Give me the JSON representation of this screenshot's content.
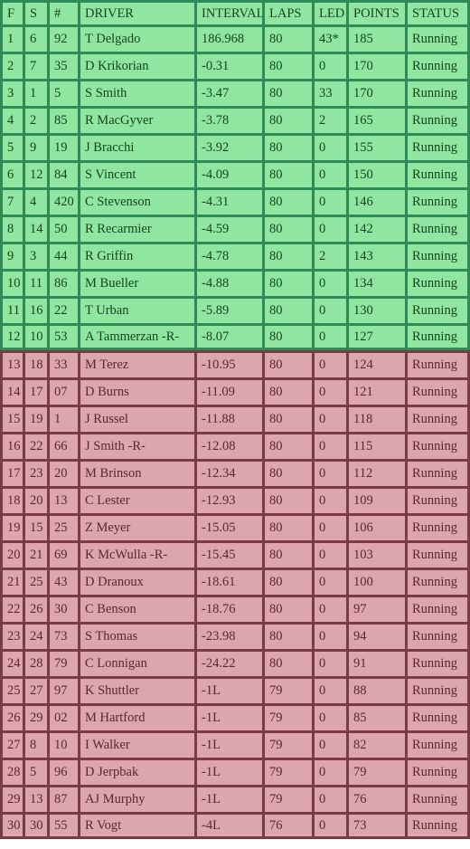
{
  "table": {
    "columns": [
      {
        "key": "f",
        "label": "F",
        "cls": "c-f"
      },
      {
        "key": "s",
        "label": "S",
        "cls": "c-s"
      },
      {
        "key": "num",
        "label": "#",
        "cls": "c-num"
      },
      {
        "key": "driver",
        "label": "DRIVER",
        "cls": "c-driver"
      },
      {
        "key": "interval",
        "label": "INTERVAL",
        "cls": "c-interval"
      },
      {
        "key": "laps",
        "label": "LAPS",
        "cls": "c-laps"
      },
      {
        "key": "led",
        "label": "LED",
        "cls": "c-led"
      },
      {
        "key": "points",
        "label": "POINTS",
        "cls": "c-points"
      },
      {
        "key": "status",
        "label": "STATUS",
        "cls": "c-status"
      }
    ],
    "colors": {
      "green_cell": "#90e6a0",
      "green_border": "#2e8b57",
      "green_text": "#14451e",
      "pink_cell": "#dda5ad",
      "pink_border": "#7b3b45",
      "pink_text": "#5d2630"
    },
    "rows": [
      {
        "group": "green",
        "f": "1",
        "s": "6",
        "num": "92",
        "driver": "T Delgado",
        "interval": "186.968",
        "laps": "80",
        "led": "43*",
        "points": "185",
        "status": "Running"
      },
      {
        "group": "green",
        "f": "2",
        "s": "7",
        "num": "35",
        "driver": "D Krikorian",
        "interval": "-0.31",
        "laps": "80",
        "led": "0",
        "points": "170",
        "status": "Running"
      },
      {
        "group": "green",
        "f": "3",
        "s": "1",
        "num": "5",
        "driver": "S Smith",
        "interval": "-3.47",
        "laps": "80",
        "led": "33",
        "points": "170",
        "status": "Running"
      },
      {
        "group": "green",
        "f": "4",
        "s": "2",
        "num": "85",
        "driver": "R MacGyver",
        "interval": "-3.78",
        "laps": "80",
        "led": "2",
        "points": "165",
        "status": "Running"
      },
      {
        "group": "green",
        "f": "5",
        "s": "9",
        "num": "19",
        "driver": "J Bracchi",
        "interval": "-3.92",
        "laps": "80",
        "led": "0",
        "points": "155",
        "status": "Running"
      },
      {
        "group": "green",
        "f": "6",
        "s": "12",
        "num": "84",
        "driver": "S Vincent",
        "interval": "-4.09",
        "laps": "80",
        "led": "0",
        "points": "150",
        "status": "Running"
      },
      {
        "group": "green",
        "f": "7",
        "s": "4",
        "num": "420",
        "driver": "C Stevenson",
        "interval": "-4.31",
        "laps": "80",
        "led": "0",
        "points": "146",
        "status": "Running"
      },
      {
        "group": "green",
        "f": "8",
        "s": "14",
        "num": "50",
        "driver": "R Recarmier",
        "interval": "-4.59",
        "laps": "80",
        "led": "0",
        "points": "142",
        "status": "Running"
      },
      {
        "group": "green",
        "f": "9",
        "s": "3",
        "num": "44",
        "driver": "R Griffin",
        "interval": "-4.78",
        "laps": "80",
        "led": "2",
        "points": "143",
        "status": "Running"
      },
      {
        "group": "green",
        "f": "10",
        "s": "11",
        "num": "86",
        "driver": "M Bueller",
        "interval": "-4.88",
        "laps": "80",
        "led": "0",
        "points": "134",
        "status": "Running"
      },
      {
        "group": "green",
        "f": "11",
        "s": "16",
        "num": "22",
        "driver": "T Urban",
        "interval": "-5.89",
        "laps": "80",
        "led": "0",
        "points": "130",
        "status": "Running"
      },
      {
        "group": "green",
        "f": "12",
        "s": "10",
        "num": "53",
        "driver": "A Tammerzan -R-",
        "interval": "-8.07",
        "laps": "80",
        "led": "0",
        "points": "127",
        "status": "Running"
      },
      {
        "group": "pink",
        "f": "13",
        "s": "18",
        "num": "33",
        "driver": "M Terez",
        "interval": "-10.95",
        "laps": "80",
        "led": "0",
        "points": "124",
        "status": "Running"
      },
      {
        "group": "pink",
        "f": "14",
        "s": "17",
        "num": "07",
        "driver": "D Burns",
        "interval": "-11.09",
        "laps": "80",
        "led": "0",
        "points": "121",
        "status": "Running"
      },
      {
        "group": "pink",
        "f": "15",
        "s": "19",
        "num": "1",
        "driver": "J Russel",
        "interval": "-11.88",
        "laps": "80",
        "led": "0",
        "points": "118",
        "status": "Running"
      },
      {
        "group": "pink",
        "f": "16",
        "s": "22",
        "num": "66",
        "driver": "J Smith -R-",
        "interval": "-12.08",
        "laps": "80",
        "led": "0",
        "points": "115",
        "status": "Running"
      },
      {
        "group": "pink",
        "f": "17",
        "s": "23",
        "num": "20",
        "driver": "M Brinson",
        "interval": "-12.34",
        "laps": "80",
        "led": "0",
        "points": "112",
        "status": "Running"
      },
      {
        "group": "pink",
        "f": "18",
        "s": "20",
        "num": "13",
        "driver": "C Lester",
        "interval": "-12.93",
        "laps": "80",
        "led": "0",
        "points": "109",
        "status": "Running"
      },
      {
        "group": "pink",
        "f": "19",
        "s": "15",
        "num": "25",
        "driver": "Z Meyer",
        "interval": "-15.05",
        "laps": "80",
        "led": "0",
        "points": "106",
        "status": "Running"
      },
      {
        "group": "pink",
        "f": "20",
        "s": "21",
        "num": "69",
        "driver": "K McWulla -R-",
        "interval": "-15.45",
        "laps": "80",
        "led": "0",
        "points": "103",
        "status": "Running"
      },
      {
        "group": "pink",
        "f": "21",
        "s": "25",
        "num": "43",
        "driver": "D Dranoux",
        "interval": "-18.61",
        "laps": "80",
        "led": "0",
        "points": "100",
        "status": "Running"
      },
      {
        "group": "pink",
        "f": "22",
        "s": "26",
        "num": "30",
        "driver": "C Benson",
        "interval": "-18.76",
        "laps": "80",
        "led": "0",
        "points": "97",
        "status": "Running"
      },
      {
        "group": "pink",
        "f": "23",
        "s": "24",
        "num": "73",
        "driver": "S Thomas",
        "interval": "-23.98",
        "laps": "80",
        "led": "0",
        "points": "94",
        "status": "Running"
      },
      {
        "group": "pink",
        "f": "24",
        "s": "28",
        "num": "79",
        "driver": "C Lonnigan",
        "interval": "-24.22",
        "laps": "80",
        "led": "0",
        "points": "91",
        "status": "Running"
      },
      {
        "group": "pink",
        "f": "25",
        "s": "27",
        "num": "97",
        "driver": "K Shuttler",
        "interval": "-1L",
        "laps": "79",
        "led": "0",
        "points": "88",
        "status": "Running"
      },
      {
        "group": "pink",
        "f": "26",
        "s": "29",
        "num": "02",
        "driver": "M Hartford",
        "interval": "-1L",
        "laps": "79",
        "led": "0",
        "points": "85",
        "status": "Running"
      },
      {
        "group": "pink",
        "f": "27",
        "s": "8",
        "num": "10",
        "driver": "I Walker",
        "interval": "-1L",
        "laps": "79",
        "led": "0",
        "points": "82",
        "status": "Running"
      },
      {
        "group": "pink",
        "f": "28",
        "s": "5",
        "num": "96",
        "driver": "D Jerpbak",
        "interval": "-1L",
        "laps": "79",
        "led": "0",
        "points": "79",
        "status": "Running"
      },
      {
        "group": "pink",
        "f": "29",
        "s": "13",
        "num": "87",
        "driver": "AJ Murphy",
        "interval": "-1L",
        "laps": "79",
        "led": "0",
        "points": "76",
        "status": "Running"
      },
      {
        "group": "pink",
        "f": "30",
        "s": "30",
        "num": "55",
        "driver": "R Vogt",
        "interval": "-4L",
        "laps": "76",
        "led": "0",
        "points": "73",
        "status": "Running"
      }
    ]
  }
}
